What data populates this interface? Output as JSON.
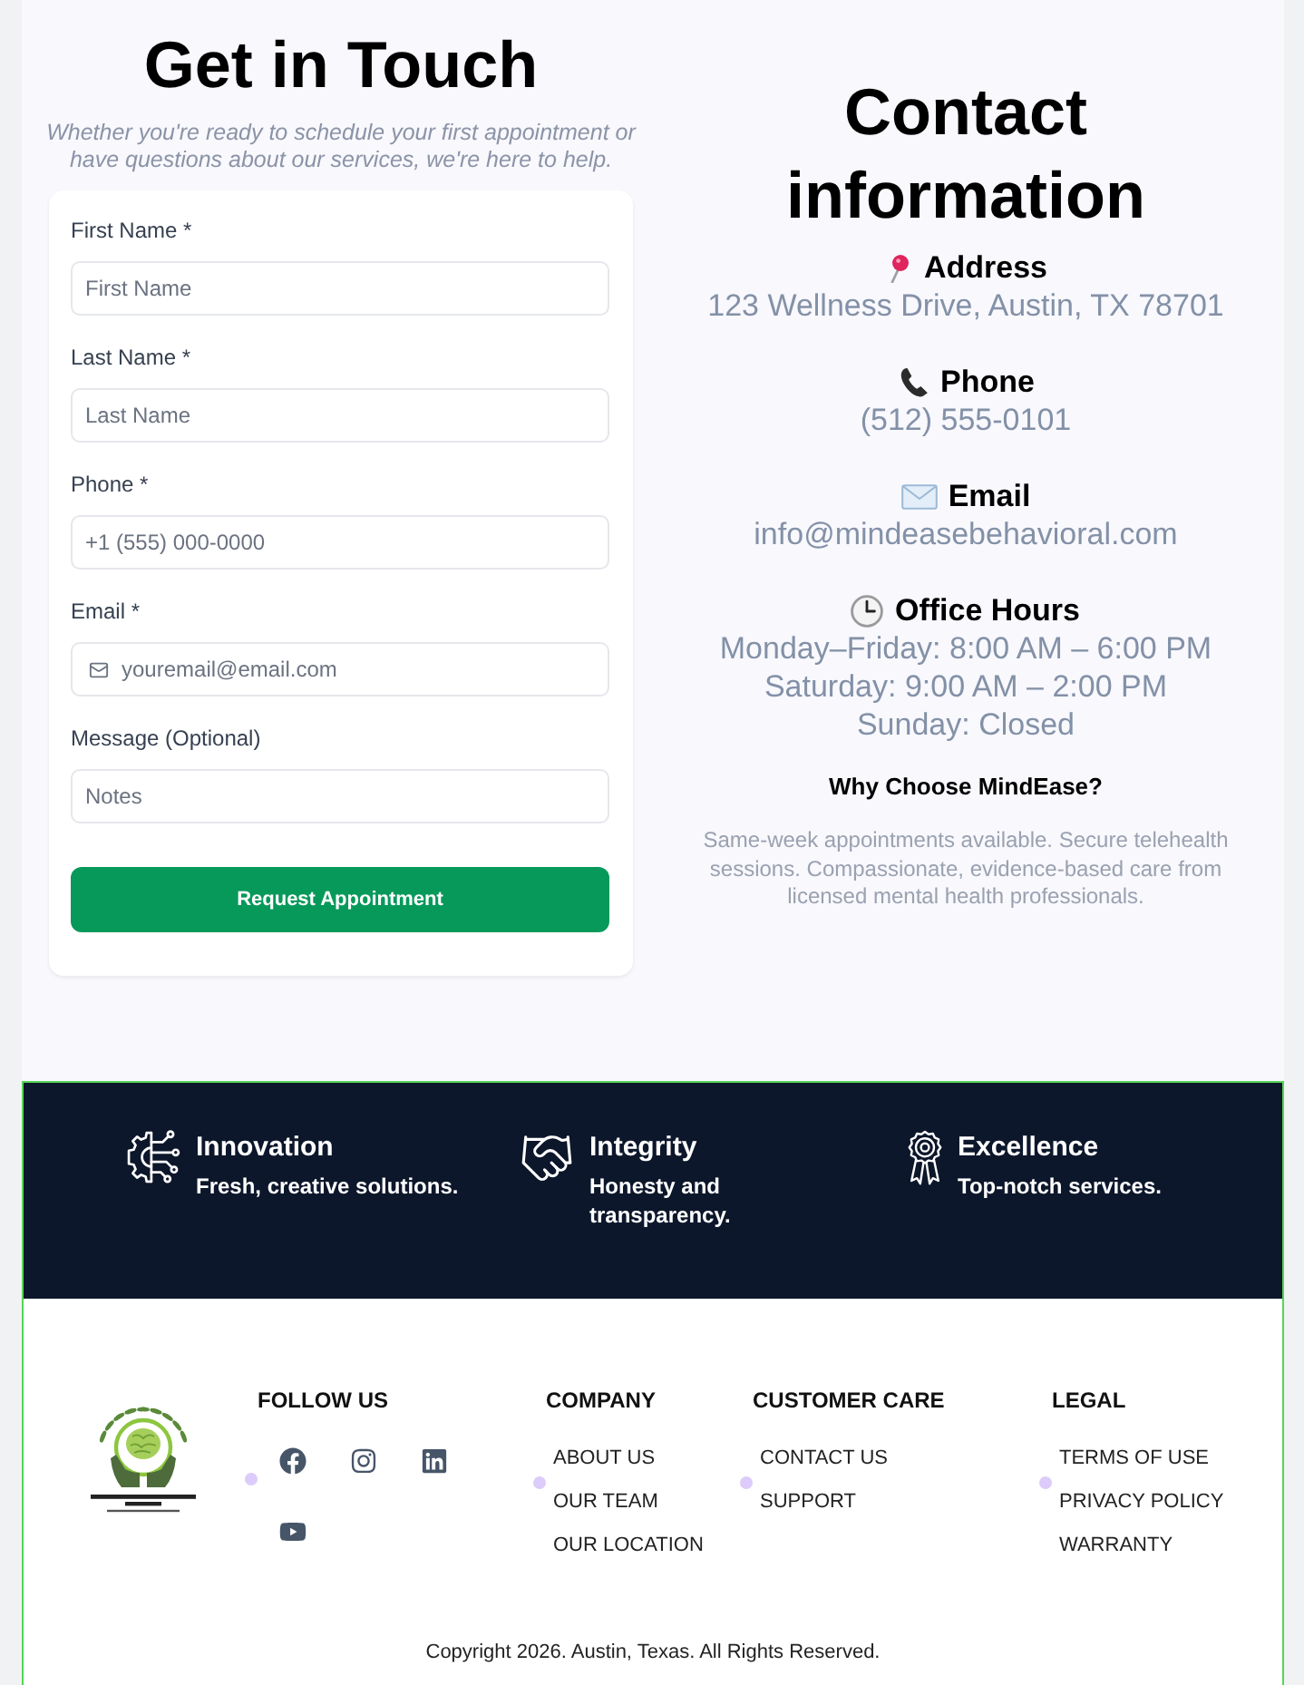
{
  "contact_form": {
    "title": "Get in Touch",
    "subtitle": "Whether you're ready to schedule your first appointment or have questions about our services, we're here to help.",
    "fields": [
      {
        "kind": "text",
        "label": "First Name *",
        "placeholder": "First Name"
      },
      {
        "kind": "text",
        "label": "Last Name *",
        "placeholder": "Last Name"
      },
      {
        "kind": "text",
        "label": "Phone *",
        "placeholder": "+1 (555) 000-0000"
      },
      {
        "kind": "email",
        "label": "Email *",
        "placeholder": "youremail@email.com"
      },
      {
        "kind": "text",
        "label": "Message (Optional)",
        "placeholder": "Notes"
      }
    ],
    "submit_button": "Request Appointment"
  },
  "contact_info": {
    "title": "Contact information",
    "sections": [
      {
        "kind": "address",
        "label": "Address",
        "lines": [
          "123 Wellness Drive, Austin, TX 78701"
        ]
      },
      {
        "kind": "phone",
        "label": "Phone",
        "lines": [
          "(512) 555-0101"
        ]
      },
      {
        "kind": "email",
        "label": "Email",
        "lines": [
          "info@mindeasebehavioral.com"
        ]
      },
      {
        "kind": "hours",
        "label": "Office Hours",
        "lines": [
          "Monday–Friday: 8:00 AM – 6:00 PM",
          "Saturday: 9:00 AM – 2:00 PM",
          "Sunday: Closed"
        ]
      }
    ],
    "why_title": "Why Choose MindEase?",
    "why_text": "Same-week appointments available. Secure telehealth sessions. Compassionate, evidence-based care from licensed mental health professionals."
  },
  "values": [
    {
      "kind": "innovation",
      "title": "Innovation",
      "description": "Fresh, creative solutions."
    },
    {
      "kind": "integrity",
      "title": "Integrity",
      "description": "Honesty and transparency."
    },
    {
      "kind": "excellence",
      "title": "Excellence",
      "description": "Top-notch services."
    }
  ],
  "footer": {
    "follow_heading": "FOLLOW US",
    "social_links": [
      {
        "kind": "facebook"
      },
      {
        "kind": "instagram"
      },
      {
        "kind": "linkedin"
      },
      {
        "kind": "youtube"
      }
    ],
    "columns": [
      {
        "heading": "COMPANY",
        "links": [
          "ABOUT US",
          "OUR TEAM",
          "OUR LOCATION"
        ]
      },
      {
        "heading": "CUSTOMER CARE",
        "links": [
          "CONTACT US",
          "SUPPORT"
        ]
      },
      {
        "heading": "LEGAL",
        "links": [
          "TERMS OF USE",
          "PRIVACY POLICY",
          "WARRANTY"
        ]
      }
    ],
    "copyright": "Copyright 2026. Austin, Texas. All Rights Reserved."
  }
}
